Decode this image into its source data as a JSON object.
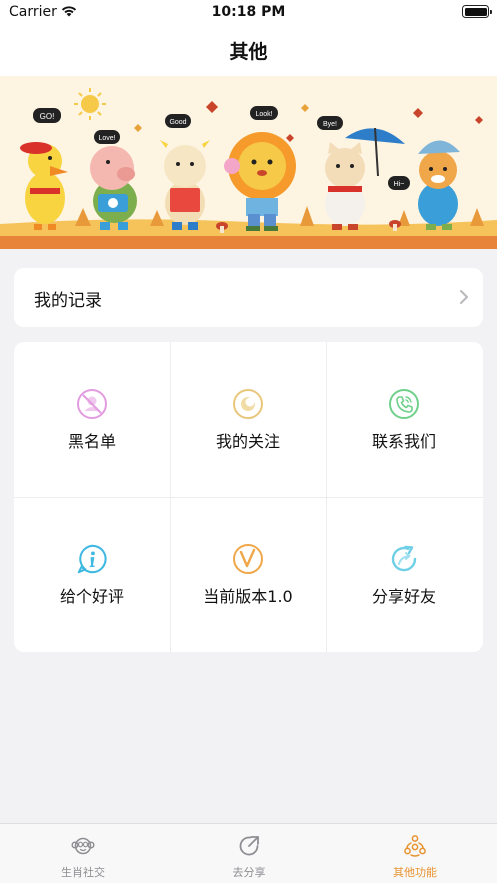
{
  "status_bar": {
    "carrier": "Carrier",
    "time": "10:18 PM"
  },
  "nav": {
    "title": "其他"
  },
  "banner": {
    "speech_bubbles": [
      "GO!",
      "Love!",
      "Good",
      "Look!",
      "Bye!",
      "Hi~"
    ]
  },
  "record": {
    "label": "我的记录"
  },
  "grid": {
    "items": [
      {
        "label": "黑名单",
        "icon": "blacklist-icon",
        "color": "#e39cdf"
      },
      {
        "label": "我的关注",
        "icon": "follow-icon",
        "color": "#e9c77a"
      },
      {
        "label": "联系我们",
        "icon": "phone-icon",
        "color": "#6fd18b"
      },
      {
        "label": "给个好评",
        "icon": "info-bubble-icon",
        "color": "#3fb9e2"
      },
      {
        "label": "当前版本1.0",
        "icon": "version-icon",
        "color": "#f0a74a"
      },
      {
        "label": "分享好友",
        "icon": "share-icon",
        "color": "#6fcfe6"
      }
    ]
  },
  "tabs": [
    {
      "label": "生肖社交",
      "icon": "monkey-icon",
      "active": false
    },
    {
      "label": "去分享",
      "icon": "share-arrow-icon",
      "active": false
    },
    {
      "label": "其他功能",
      "icon": "zodiac-people-icon",
      "active": true
    }
  ],
  "colors": {
    "accent": "#e8922e",
    "inactive": "#8e8e93"
  }
}
